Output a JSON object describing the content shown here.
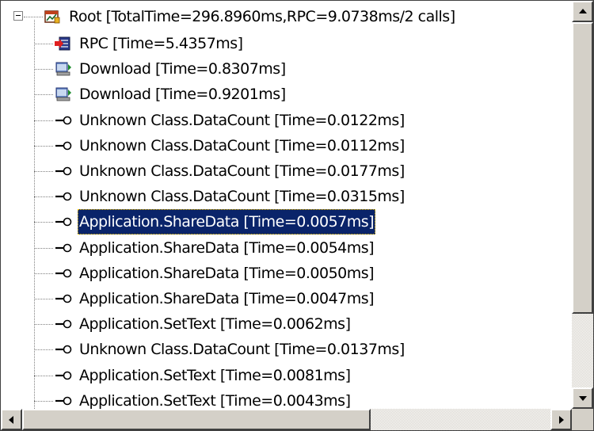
{
  "tree": {
    "root": {
      "label": "Root [TotalTime=296.8960ms,RPC=9.0738ms/2 calls]",
      "icon": "root-node-icon"
    },
    "items": [
      {
        "label": "RPC [Time=5.4357ms]",
        "icon": "rpc-icon"
      },
      {
        "label": "Download [Time=0.8307ms]",
        "icon": "download-icon"
      },
      {
        "label": "Download [Time=0.9201ms]",
        "icon": "download-icon"
      },
      {
        "label": "Unknown Class.DataCount [Time=0.0122ms]",
        "icon": "method-call-icon"
      },
      {
        "label": "Unknown Class.DataCount [Time=0.0112ms]",
        "icon": "method-call-icon"
      },
      {
        "label": "Unknown Class.DataCount [Time=0.0177ms]",
        "icon": "method-call-icon"
      },
      {
        "label": "Unknown Class.DataCount [Time=0.0315ms]",
        "icon": "method-call-icon"
      },
      {
        "label": "Application.ShareData [Time=0.0057ms]",
        "icon": "method-call-icon",
        "selected": true
      },
      {
        "label": "Application.ShareData [Time=0.0054ms]",
        "icon": "method-call-icon"
      },
      {
        "label": "Application.ShareData [Time=0.0050ms]",
        "icon": "method-call-icon"
      },
      {
        "label": "Application.ShareData [Time=0.0047ms]",
        "icon": "method-call-icon"
      },
      {
        "label": "Application.SetText [Time=0.0062ms]",
        "icon": "method-call-icon"
      },
      {
        "label": "Unknown Class.DataCount [Time=0.0137ms]",
        "icon": "method-call-icon"
      },
      {
        "label": "Application.SetText [Time=0.0081ms]",
        "icon": "method-call-icon"
      },
      {
        "label": "Application.SetText [Time=0.0043ms]",
        "icon": "method-call-icon"
      }
    ]
  },
  "colors": {
    "selection_bg": "#0a246a",
    "selection_fg": "#ffffff",
    "scrollbar_face": "#d4d0c8"
  }
}
